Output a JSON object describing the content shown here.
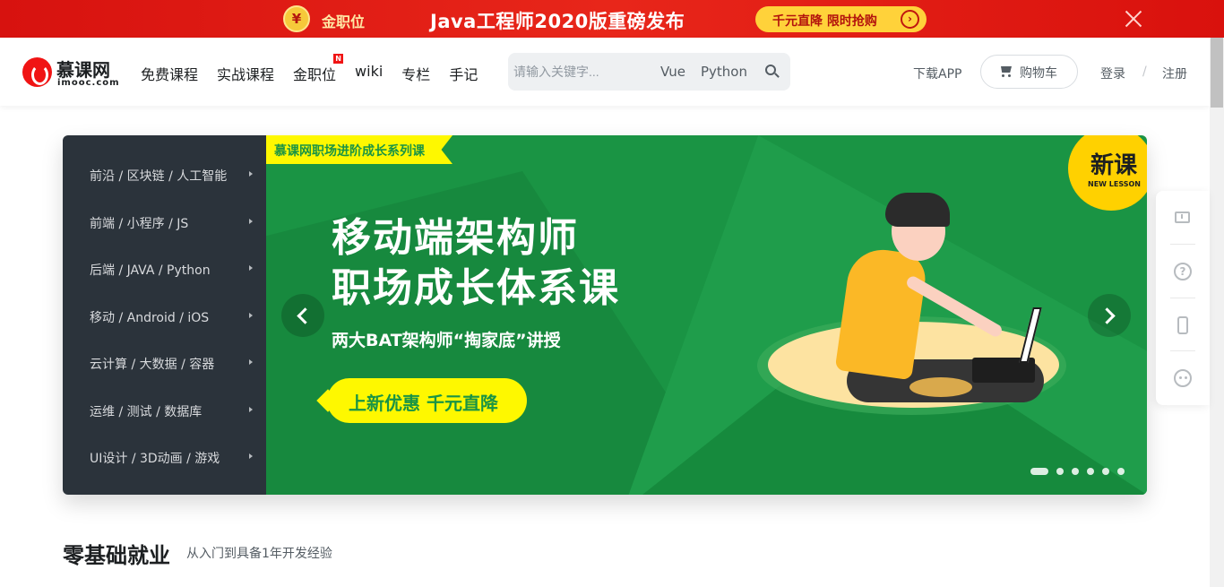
{
  "promo_banner": {
    "brand": "金职位",
    "headline": "Java工程师2020版重磅发布",
    "cta": "千元直降  限时抢购"
  },
  "header": {
    "logo_cn": "慕课网",
    "logo_en": "imooc.com",
    "nav": [
      "免费课程",
      "实战课程",
      "金职位",
      "wiki",
      "专栏",
      "手记"
    ],
    "nav_new_badge": "N",
    "search": {
      "placeholder": "请输入关键字...",
      "hot_tags": [
        "Vue",
        "Python"
      ]
    },
    "download_app": "下载APP",
    "cart": "购物车",
    "login": "登录",
    "separator": "/",
    "register": "注册"
  },
  "side_menu": [
    "前沿 / 区块链 / 人工智能",
    "前端 / 小程序 / JS",
    "后端 / JAVA / Python",
    "移动 / Android / iOS",
    "云计算 / 大数据 / 容器",
    "运维 / 测试 / 数据库",
    "UI设计 / 3D动画 / 游戏"
  ],
  "banner": {
    "series_tag": "慕课网职场进阶成长系列课",
    "title_line1": "移动端架构师",
    "title_line2": "职场成长体系课",
    "subtitle": "两大BAT架构师“掏家底”讲授",
    "promo": "上新优惠  千元直降",
    "badge_big": "新课",
    "badge_small": "NEW LESSON",
    "slide_count": 6,
    "active_slide": 1
  },
  "section": {
    "title": "零基础就业",
    "subtitle": "从入门到具备1年开发经验"
  },
  "colors": {
    "brand_red": "#f01414",
    "banner_green": "#1a9444",
    "highlight_yellow": "#fef800",
    "side_menu_bg": "#2b333b"
  }
}
